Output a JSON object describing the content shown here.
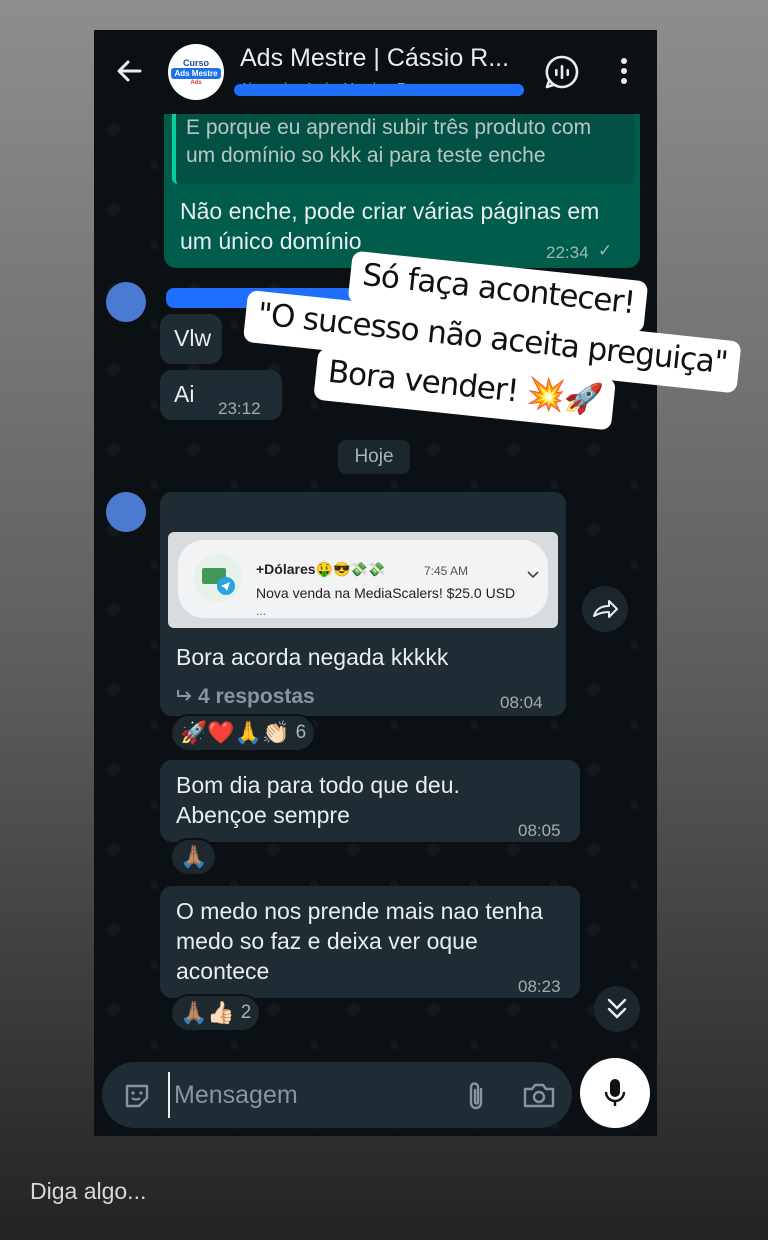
{
  "header": {
    "title": "Ads Mestre | Cássio R...",
    "subtitle": "Alexandre, Andre Mendes, Em...",
    "avatar_text": [
      "Curso",
      "Ads Mestre",
      "Ads"
    ]
  },
  "messages": {
    "msg1": {
      "quote": "E porque eu aprendi subir três produto com um domínio so kkk ai para teste enche",
      "text": "Não enche, pode criar várias páginas em um único domínio",
      "time": "22:34",
      "status": "✓"
    },
    "msg2": {
      "text": "Vlw"
    },
    "msg3": {
      "text": "Ai",
      "time": "23:12"
    },
    "date_chip": "Hoje",
    "msg4": {
      "notification": {
        "title": "+Dólares🤑😎💸💸",
        "time": "7:45 AM",
        "body": "Nova venda na MediaScalers! $25.0 USD",
        "ellipsis": "..."
      },
      "text": "Bora acorda negada kkkkk",
      "replies": "4 respostas",
      "time": "08:04",
      "reactions": {
        "emojis": "🚀❤️🙏👏🏻",
        "count": "6"
      }
    },
    "msg5": {
      "text": "Bom dia para todo que deu. Abençoe sempre",
      "time": "08:05",
      "reactions": {
        "emojis": "🙏🏽",
        "count": ""
      }
    },
    "msg6": {
      "text": "O medo nos prende mais nao tenha medo so faz e deixa ver oque acontece",
      "time": "08:23",
      "reactions": {
        "emojis": "🙏🏽👍🏻",
        "count": "2"
      }
    }
  },
  "composer": {
    "placeholder": "Mensagem"
  },
  "story": {
    "caption_lines": [
      "Só faça acontecer!",
      "\"O sucesso não aceita preguiça\"",
      "Bora vender! 💥🚀"
    ],
    "reply_placeholder": "Diga algo..."
  },
  "colors": {
    "outgoing_bubble": "#005c4b",
    "incoming_bubble": "#202c33",
    "chat_background": "#0b1014",
    "redaction": "#1f6fff"
  }
}
